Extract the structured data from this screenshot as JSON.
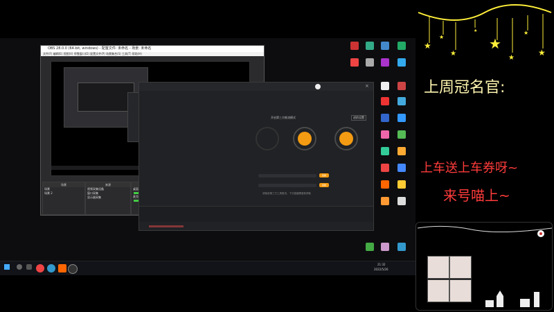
{
  "obs": {
    "title": "OBS 28.0.0 (64-bit, windows) - 配置文件: 未命名 - 场景: 未命名",
    "menu": "文件(F)  编辑(E)  视图(V)  停靠窗口(D)  配置文件(P)  场景集合(S)  工具(T)  帮助(H)",
    "docks": [
      {
        "header": "场景",
        "items": [
          "场景",
          "场景 2"
        ]
      },
      {
        "header": "来源",
        "items": [
          "视频采集设备",
          "窗口采集",
          "显示器采集"
        ]
      },
      {
        "header": "混音器",
        "items": [
          "桌面音频",
          "麦克风/Aux"
        ]
      },
      {
        "header": "转场动画",
        "items": [
          "渐变淡出"
        ]
      },
      {
        "header": "控制按钮",
        "items": [
          "开始直播",
          "开始录制",
          "工作室模式",
          "设置",
          "退出"
        ]
      }
    ]
  },
  "streamer": {
    "options_label": "进阶设置",
    "mode_label": "开启第三方推流模式",
    "fields": [
      "服务器",
      "串流密钥"
    ],
    "steps": [
      "1",
      "2",
      "3"
    ],
    "copy_btn": "复制",
    "note": "请使用第三方工具推流，下次直播需重新获取"
  },
  "panel": {
    "title": "上周冠名官:",
    "line1": "上车送上车券呀~",
    "line2": "来号喵上~"
  },
  "taskbar": {
    "time": "21:32",
    "date": "2022/5/26"
  },
  "colors": {
    "accent": "#f39b12",
    "star": "#ffef3a",
    "red_text": "#ff3b3b"
  }
}
